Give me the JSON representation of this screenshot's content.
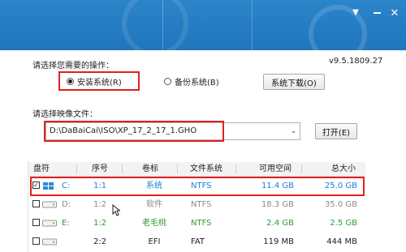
{
  "version": "v9.5.1809.27",
  "operation": {
    "label": "请选择您需要的操作：",
    "options": [
      {
        "text": "安装系统(R)",
        "selected": true
      },
      {
        "text": "备份系统(B)",
        "selected": false
      }
    ],
    "download_button": "系统下载(O)"
  },
  "image": {
    "label": "请选择映像文件：",
    "path": "D:\\DaBaiCai\\ISO\\XP_17_2_17_1.GHO",
    "open_button": "打开(E)"
  },
  "table": {
    "headers": [
      "盘符",
      "序号",
      "卷标",
      "文件系统",
      "可用空间",
      "总大小"
    ],
    "rows": [
      {
        "checked": true,
        "drive": "C:",
        "index": "1:1",
        "label": "系统",
        "fs": "NTFS",
        "free": "11.4 GB",
        "total": "25.0 GB",
        "color": "#1f7fd0"
      },
      {
        "checked": false,
        "drive": "D:",
        "index": "1:2",
        "label": "软件",
        "fs": "NTFS",
        "free": "18.3 GB",
        "total": "35.0 GB",
        "color": "#8a8a8a"
      },
      {
        "checked": false,
        "drive": "E:",
        "index": "1:2",
        "label": "老毛桃",
        "fs": "NTFS",
        "free": "2.4 GB",
        "total": "2.5 GB",
        "color": "#2e9b2e"
      },
      {
        "checked": false,
        "drive": "",
        "index": "2:2",
        "label": "EFI",
        "fs": "FAT",
        "free": "119 MB",
        "total": "444 MB",
        "color": "#222222"
      }
    ]
  },
  "colors": {
    "header": "#2280c6",
    "highlight": "#e02020"
  }
}
